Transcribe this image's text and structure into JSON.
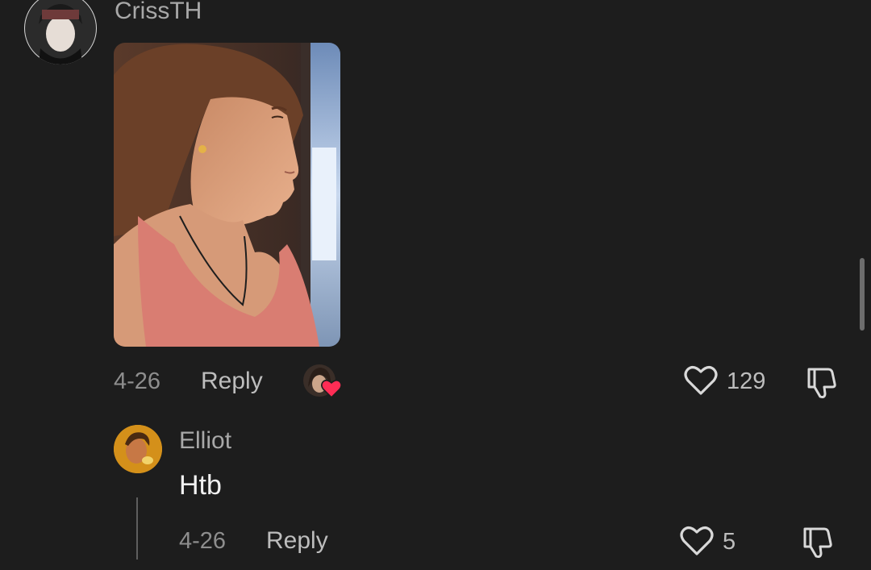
{
  "comments": [
    {
      "username": "CrissTH",
      "date": "4-26",
      "reply_label": "Reply",
      "likes": "129",
      "creator_liked": true
    },
    {
      "username": "Elliot",
      "text": "Htb",
      "date": "4-26",
      "reply_label": "Reply",
      "likes": "5"
    }
  ],
  "colors": {
    "background": "#1d1d1d",
    "heart_badge": "#ff2d55"
  },
  "icons": [
    "heart-outline-icon",
    "thumbs-down-icon",
    "heart-badge-icon"
  ]
}
